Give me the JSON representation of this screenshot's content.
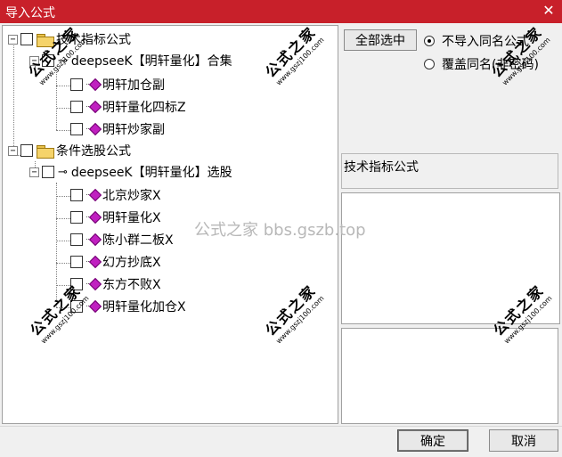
{
  "window": {
    "title": "导入公式",
    "close_glyph": "✕"
  },
  "tree": {
    "expanded_glyph": "−",
    "key_glyph": "⊸",
    "groups": [
      {
        "label": "技术指标公式",
        "child": {
          "label": "deepseeK【明轩量化】合集",
          "items": [
            "明轩加仓副",
            "明轩量化四标Z",
            "明轩炒家副"
          ]
        }
      },
      {
        "label": "条件选股公式",
        "child": {
          "label": "deepseeK【明轩量化】选股",
          "items": [
            "北京炒家X",
            "明轩量化X",
            "陈小群二板X",
            "幻方抄底X",
            "东方不败X",
            "明轩量化加仓X"
          ]
        }
      }
    ]
  },
  "side": {
    "select_all_label": "全部选中",
    "radio_skip_label": "不导入同名公式",
    "radio_overwrite_label": "覆盖同名(非密码)",
    "selected_type_label": "技术指标公式"
  },
  "watermark": {
    "text": "公式之家 bbs.gszb.top",
    "stamp_title": "公式之家",
    "stamp_url": "www.gszj100.com"
  },
  "footer": {
    "confirm_label": "确定",
    "cancel_label": "取消"
  }
}
